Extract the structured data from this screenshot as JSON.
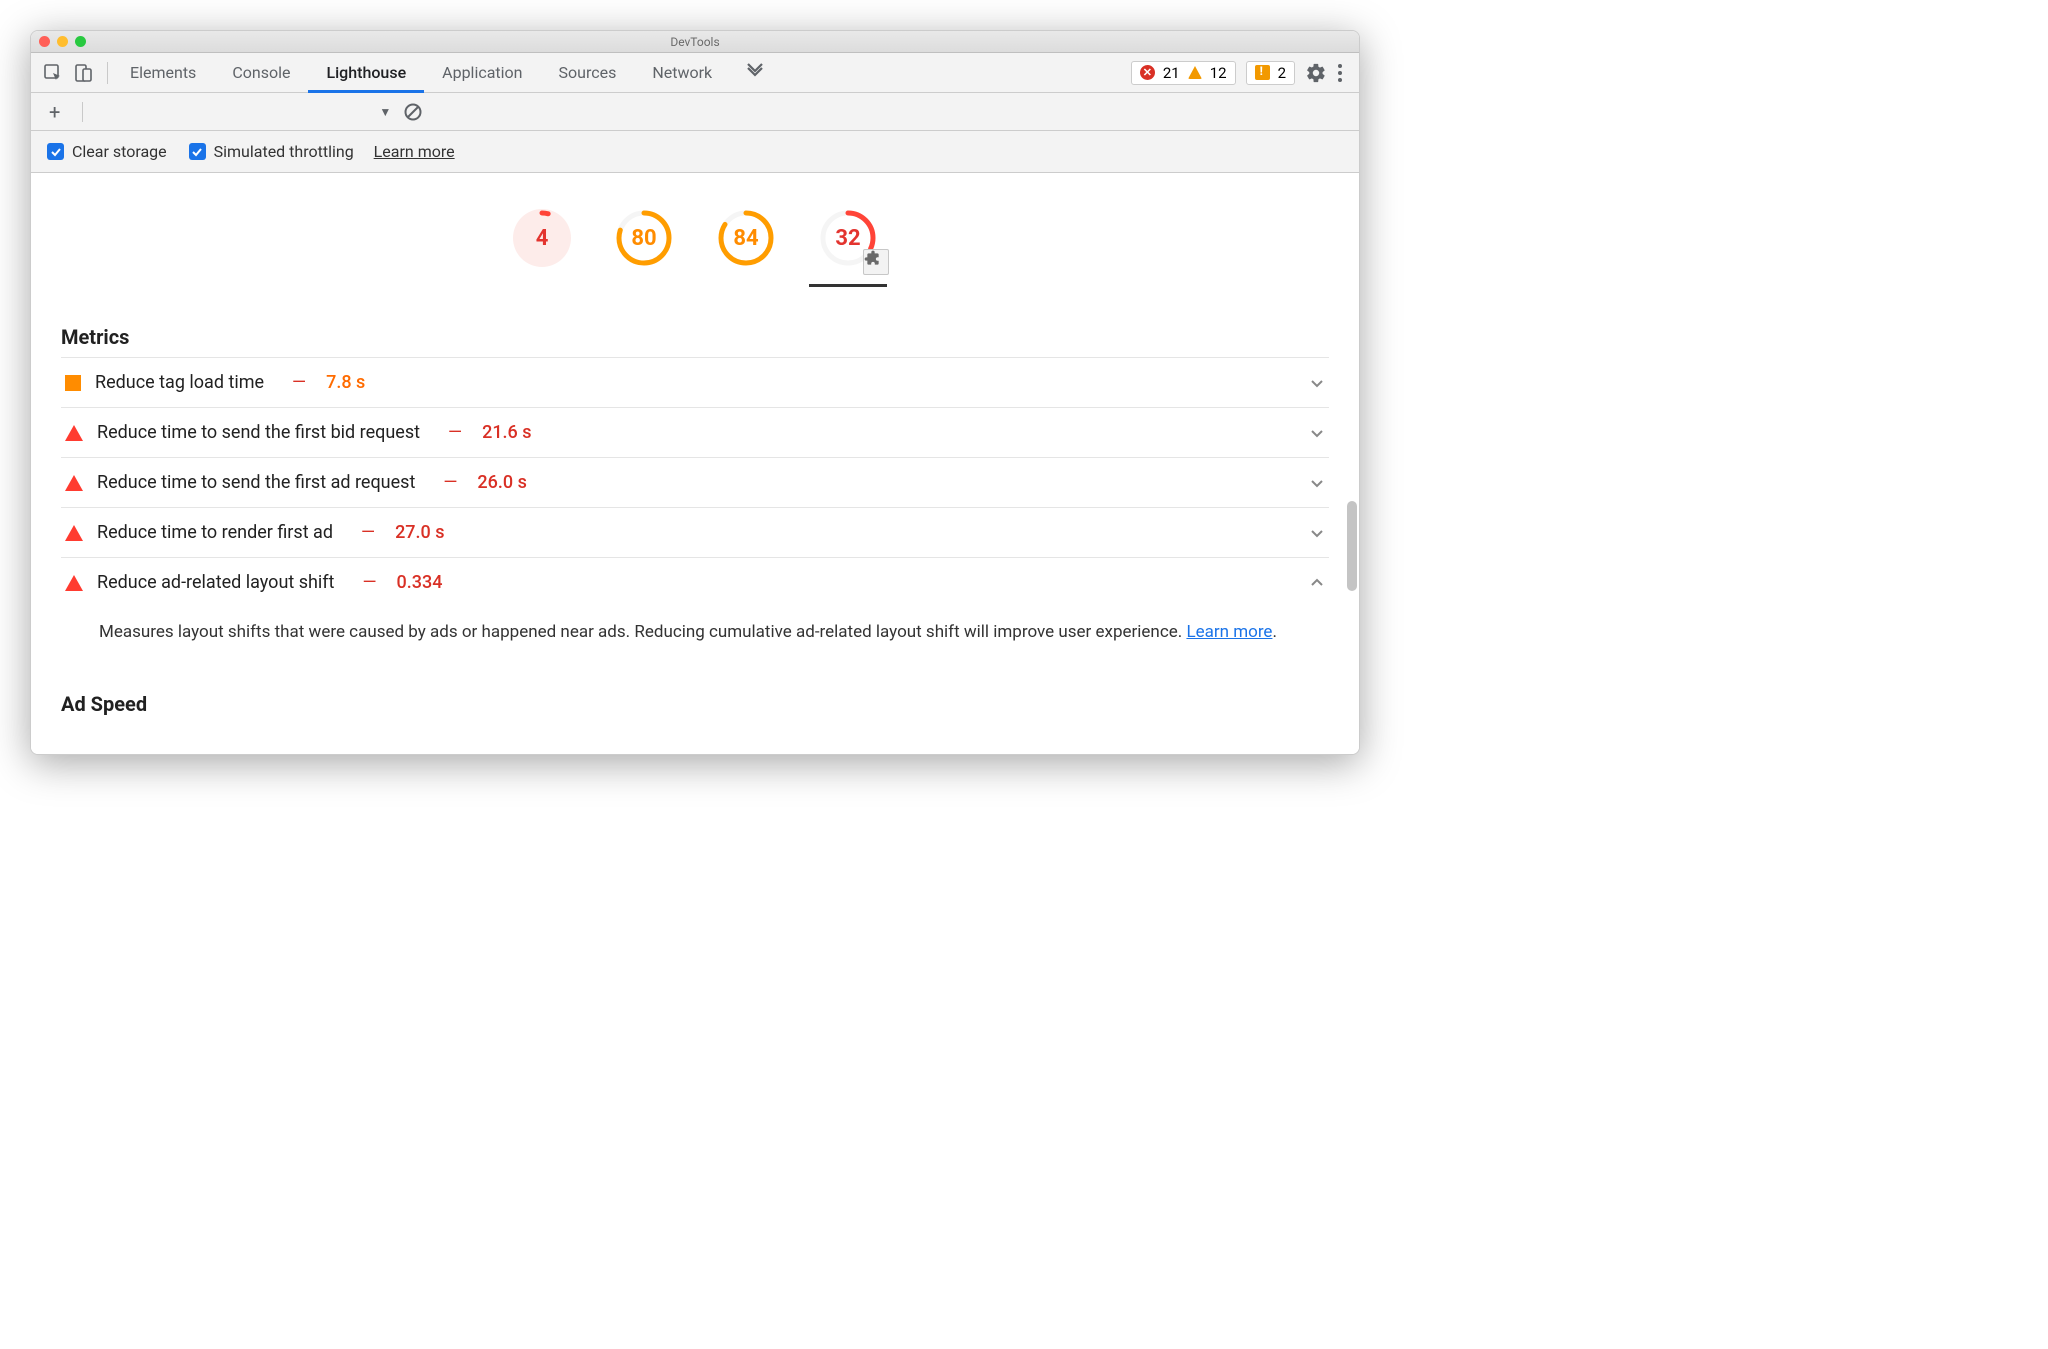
{
  "window": {
    "title": "DevTools"
  },
  "tabs": {
    "items": [
      "Elements",
      "Console",
      "Lighthouse",
      "Application",
      "Sources",
      "Network"
    ],
    "active_index": 2
  },
  "counters": {
    "errors": "21",
    "warnings": "12",
    "recordings": "2"
  },
  "options": {
    "clear_storage": "Clear storage",
    "simulated_throttling": "Simulated throttling",
    "learn_more": "Learn more"
  },
  "gauges": [
    {
      "value": 4,
      "color": "red",
      "fill_bg": true
    },
    {
      "value": 80,
      "color": "orange",
      "fill_bg": false
    },
    {
      "value": 84,
      "color": "orange",
      "fill_bg": false
    },
    {
      "value": 32,
      "color": "red",
      "fill_bg": false,
      "selected": true,
      "has_plugin": true
    }
  ],
  "sections": {
    "metrics_title": "Metrics",
    "ad_speed_title": "Ad Speed"
  },
  "metrics": [
    {
      "sev": "square",
      "label": "Reduce tag load time",
      "value": "7.8 s",
      "val_color": "orange",
      "expanded": false
    },
    {
      "sev": "tri",
      "label": "Reduce time to send the first bid request",
      "value": "21.6 s",
      "val_color": "red",
      "expanded": false
    },
    {
      "sev": "tri",
      "label": "Reduce time to send the first ad request",
      "value": "26.0 s",
      "val_color": "red",
      "expanded": false
    },
    {
      "sev": "tri",
      "label": "Reduce time to render first ad",
      "value": "27.0 s",
      "val_color": "red",
      "expanded": false
    },
    {
      "sev": "tri",
      "label": "Reduce ad-related layout shift",
      "value": "0.334",
      "val_color": "red",
      "expanded": true,
      "detail": "Measures layout shifts that were caused by ads or happened near ads. Reducing cumulative ad-related layout shift will improve user experience. ",
      "detail_link": "Learn more"
    }
  ]
}
